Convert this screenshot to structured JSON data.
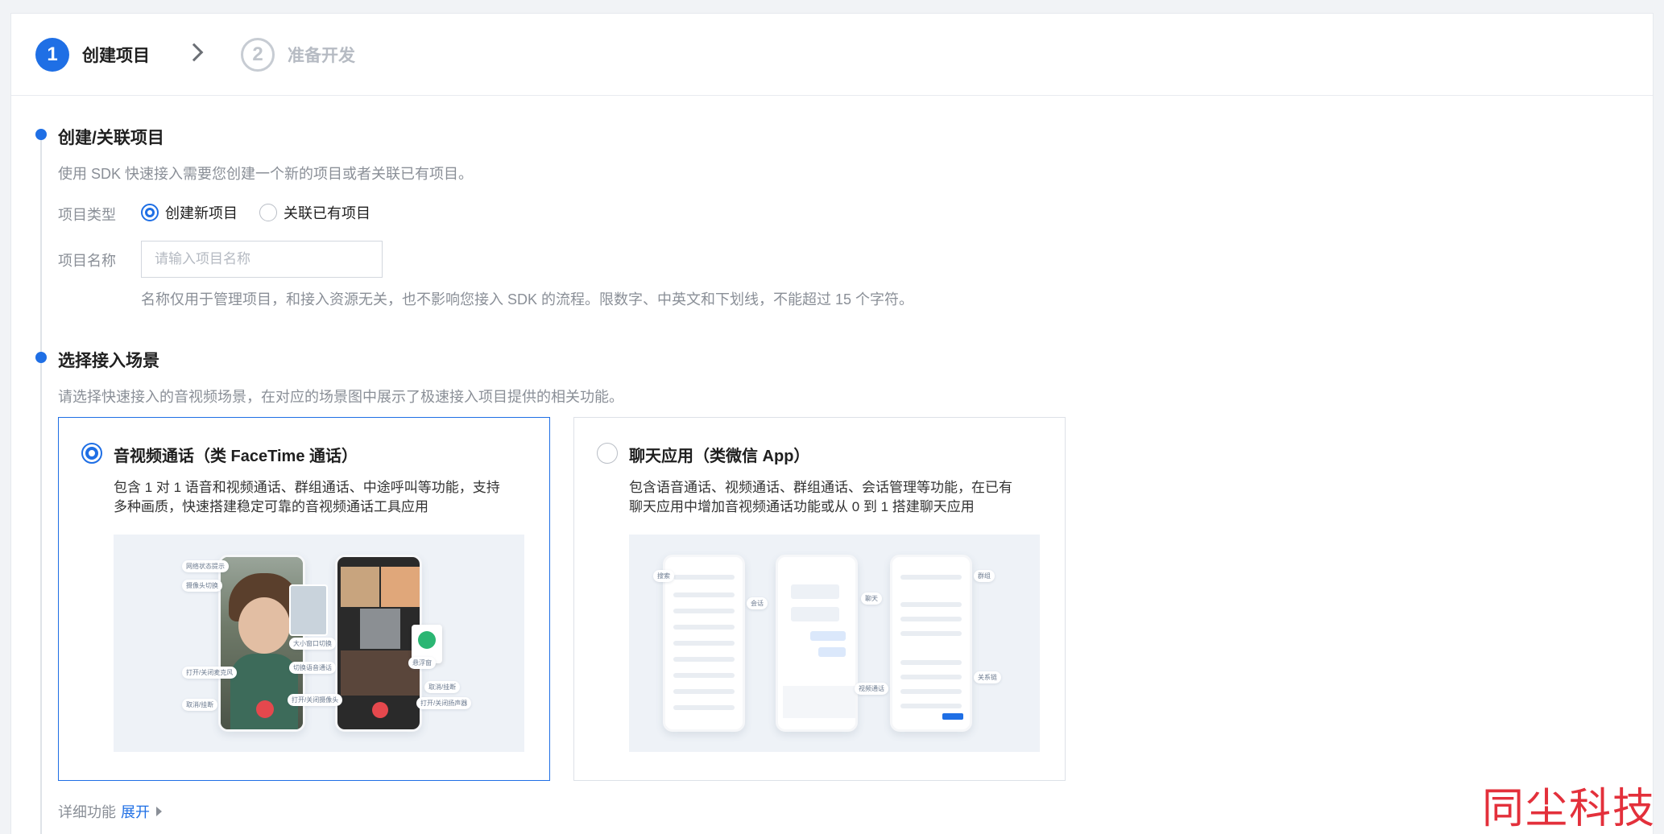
{
  "steps": [
    {
      "number": "1",
      "label": "创建项目"
    },
    {
      "number": "2",
      "label": "准备开发"
    }
  ],
  "section1": {
    "title": "创建/关联项目",
    "description": "使用 SDK 快速接入需要您创建一个新的项目或者关联已有项目。",
    "type_label": "项目类型",
    "options": [
      "创建新项目",
      "关联已有项目"
    ],
    "selected_option": "创建新项目",
    "name_label": "项目名称",
    "name_value": "",
    "name_placeholder": "请输入项目名称",
    "hint": "名称仅用于管理项目，和接入资源无关，也不影响您接入 SDK 的流程。限数字、中英文和下划线，不能超过 15 个字符。"
  },
  "section2": {
    "title": "选择接入场景",
    "description": "请选择快速接入的音视频场景，在对应的场景图中展示了极速接入项目提供的相关功能。",
    "scenes": [
      {
        "title": "音视频通话（类 FaceTime 通话）",
        "desc_line1": "包含 1 对 1 语音和视频通话、群组通话、中途呼叫等功能，支持",
        "desc_line2": "多种画质，快速搭建稳定可靠的音视频通话工具应用",
        "selected": true,
        "tags": [
          "网络状态提示",
          "摄像头切换",
          "打开/关闭麦克风",
          "取消/挂断",
          "大小窗口切换",
          "切换语音通话",
          "打开/关闭摄像头",
          "取消/挂断",
          "打开/关闭扬声器",
          "悬浮窗"
        ]
      },
      {
        "title": "聊天应用（类微信 App）",
        "desc_line1": "包含语音通话、视频通话、群组通话、会话管理等功能，在已有",
        "desc_line2": "聊天应用中增加音视频通话功能或从 0 到 1 搭建聊天应用",
        "selected": false,
        "tags": [
          "搜索",
          "会话",
          "聊天",
          "视频通话",
          "群组",
          "关系链"
        ]
      }
    ]
  },
  "footer": {
    "detail_label": "详细功能",
    "expand_link": "展开"
  },
  "watermark": "同尘科技",
  "colors": {
    "primary": "#1f6fe5",
    "watermark": "#e3303b"
  }
}
